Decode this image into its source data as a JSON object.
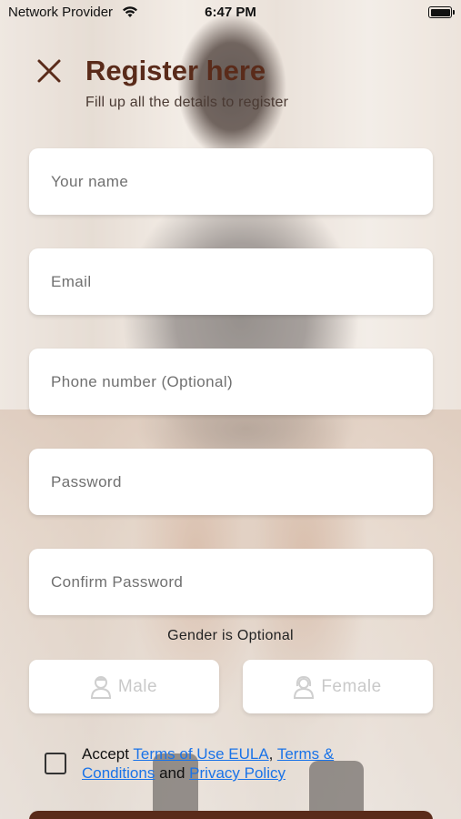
{
  "status_bar": {
    "carrier": "Network Provider",
    "time": "6:47 PM",
    "icons": [
      "wifi-icon",
      "battery-icon"
    ]
  },
  "header": {
    "close_icon": "close-icon",
    "title": "Register here",
    "subtitle": "Fill up all the details to register"
  },
  "form": {
    "name_placeholder": "Your name",
    "email_placeholder": "Email",
    "phone_placeholder": "Phone number (Optional)",
    "password_placeholder": "Password",
    "confirm_password_placeholder": "Confirm Password"
  },
  "gender": {
    "label": "Gender is Optional",
    "male": "Male",
    "female": "Female",
    "male_icon": "male-avatar-icon",
    "female_icon": "female-avatar-icon"
  },
  "terms": {
    "accept": "Accept",
    "terms_of_use": "Terms of Use EULA",
    "comma": ",",
    "terms_and": "Terms &",
    "conditions": "Conditions",
    "and": "and",
    "privacy": "Privacy Policy"
  },
  "colors": {
    "accent": "#5a2b1a",
    "link": "#1a73e8"
  }
}
